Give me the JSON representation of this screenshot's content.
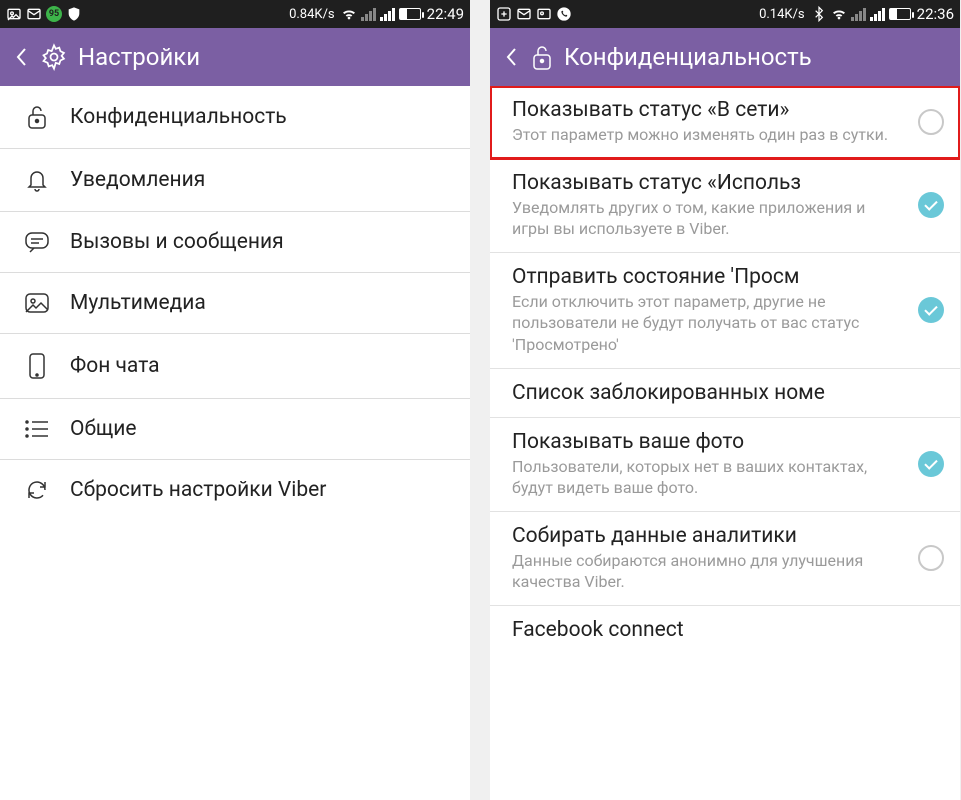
{
  "left": {
    "status": {
      "speed": "0.84K/s",
      "time": "22:49",
      "badge": "95"
    },
    "header": {
      "title": "Настройки"
    },
    "items": [
      {
        "label": "Конфиденциальность"
      },
      {
        "label": "Уведомления"
      },
      {
        "label": "Вызовы и сообщения"
      },
      {
        "label": "Мультимедиа"
      },
      {
        "label": "Фон чата"
      },
      {
        "label": "Общие"
      },
      {
        "label": "Сбросить настройки Viber"
      }
    ]
  },
  "right": {
    "status": {
      "speed": "0.14K/s",
      "time": "22:36"
    },
    "header": {
      "title": "Конфиденциальность"
    },
    "items": [
      {
        "title": "Показывать статус «В сети»",
        "sub": "Этот параметр можно изменять один раз в сутки.",
        "checked": false,
        "highlight": true
      },
      {
        "title": "Показывать статус «Использ",
        "sub": "Уведомлять других о том, какие приложения и игры вы используете в Viber.",
        "checked": true
      },
      {
        "title": "Отправить состояние 'Просм",
        "sub": "Если отключить этот параметр, другие не пользователи не будут получать от вас статус 'Просмотрено'",
        "checked": true
      },
      {
        "title": "Список заблокированных номе",
        "sub": ""
      },
      {
        "title": "Показывать ваше фото",
        "sub": "Пользователи, которых нет в ваших контактах, будут видеть ваше фото.",
        "checked": true
      },
      {
        "title": "Собирать данные аналитики",
        "sub": "Данные собираются анонимно для улучшения качества Viber.",
        "checked": false
      },
      {
        "title": "Facebook connect",
        "sub": ""
      }
    ]
  }
}
